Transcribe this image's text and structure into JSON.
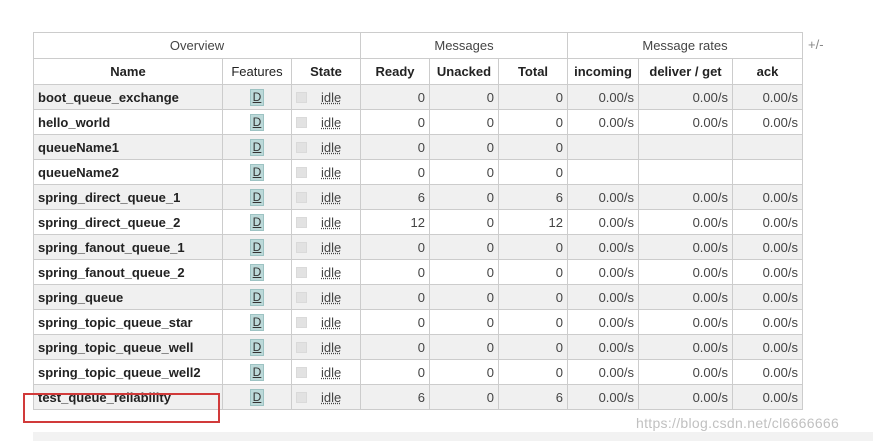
{
  "groups": {
    "overview": "Overview",
    "messages": "Messages",
    "rates": "Message rates",
    "toggle": "+/-"
  },
  "columns": {
    "name": "Name",
    "features": "Features",
    "state": "State",
    "ready": "Ready",
    "unacked": "Unacked",
    "total": "Total",
    "incoming": "incoming",
    "deliver": "deliver / get",
    "ack": "ack"
  },
  "rows": [
    {
      "name": "boot_queue_exchange",
      "feature": "D",
      "state": "idle",
      "ready": "0",
      "unacked": "0",
      "total": "0",
      "incoming": "0.00/s",
      "deliver": "0.00/s",
      "ack": "0.00/s"
    },
    {
      "name": "hello_world",
      "feature": "D",
      "state": "idle",
      "ready": "0",
      "unacked": "0",
      "total": "0",
      "incoming": "0.00/s",
      "deliver": "0.00/s",
      "ack": "0.00/s"
    },
    {
      "name": "queueName1",
      "feature": "D",
      "state": "idle",
      "ready": "0",
      "unacked": "0",
      "total": "0",
      "incoming": "",
      "deliver": "",
      "ack": ""
    },
    {
      "name": "queueName2",
      "feature": "D",
      "state": "idle",
      "ready": "0",
      "unacked": "0",
      "total": "0",
      "incoming": "",
      "deliver": "",
      "ack": ""
    },
    {
      "name": "spring_direct_queue_1",
      "feature": "D",
      "state": "idle",
      "ready": "6",
      "unacked": "0",
      "total": "6",
      "incoming": "0.00/s",
      "deliver": "0.00/s",
      "ack": "0.00/s"
    },
    {
      "name": "spring_direct_queue_2",
      "feature": "D",
      "state": "idle",
      "ready": "12",
      "unacked": "0",
      "total": "12",
      "incoming": "0.00/s",
      "deliver": "0.00/s",
      "ack": "0.00/s"
    },
    {
      "name": "spring_fanout_queue_1",
      "feature": "D",
      "state": "idle",
      "ready": "0",
      "unacked": "0",
      "total": "0",
      "incoming": "0.00/s",
      "deliver": "0.00/s",
      "ack": "0.00/s"
    },
    {
      "name": "spring_fanout_queue_2",
      "feature": "D",
      "state": "idle",
      "ready": "0",
      "unacked": "0",
      "total": "0",
      "incoming": "0.00/s",
      "deliver": "0.00/s",
      "ack": "0.00/s"
    },
    {
      "name": "spring_queue",
      "feature": "D",
      "state": "idle",
      "ready": "0",
      "unacked": "0",
      "total": "0",
      "incoming": "0.00/s",
      "deliver": "0.00/s",
      "ack": "0.00/s"
    },
    {
      "name": "spring_topic_queue_star",
      "feature": "D",
      "state": "idle",
      "ready": "0",
      "unacked": "0",
      "total": "0",
      "incoming": "0.00/s",
      "deliver": "0.00/s",
      "ack": "0.00/s"
    },
    {
      "name": "spring_topic_queue_well",
      "feature": "D",
      "state": "idle",
      "ready": "0",
      "unacked": "0",
      "total": "0",
      "incoming": "0.00/s",
      "deliver": "0.00/s",
      "ack": "0.00/s"
    },
    {
      "name": "spring_topic_queue_well2",
      "feature": "D",
      "state": "idle",
      "ready": "0",
      "unacked": "0",
      "total": "0",
      "incoming": "0.00/s",
      "deliver": "0.00/s",
      "ack": "0.00/s"
    },
    {
      "name": "test_queue_reliability",
      "feature": "D",
      "state": "idle",
      "ready": "6",
      "unacked": "0",
      "total": "6",
      "incoming": "0.00/s",
      "deliver": "0.00/s",
      "ack": "0.00/s"
    }
  ],
  "highlighted_row": "test_queue_reliability",
  "watermark": "https://blog.csdn.net/cl6666666",
  "colors": {
    "highlight": "#d13a3a",
    "feature_badge": "#bcd9d9",
    "row_alt": "#f0f0f0"
  }
}
